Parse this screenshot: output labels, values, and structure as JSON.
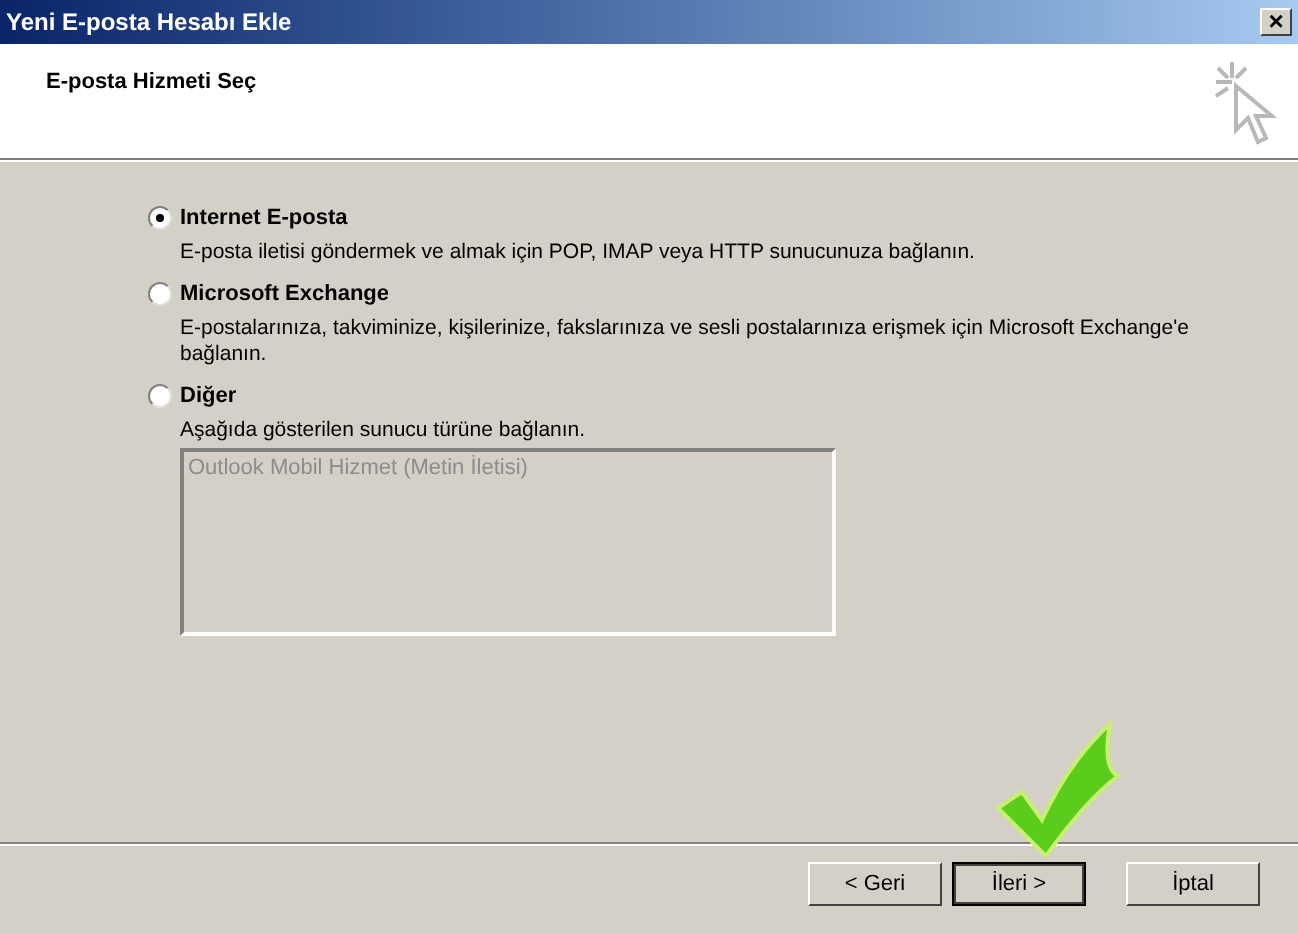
{
  "window": {
    "title": "Yeni E-posta Hesabı Ekle",
    "close": "×"
  },
  "header": {
    "title": "E-posta Hizmeti Seç"
  },
  "options": [
    {
      "label": "Internet E-posta",
      "description": "E-posta iletisi göndermek ve almak için POP, IMAP veya HTTP sunucunuza bağlanın.",
      "selected": true
    },
    {
      "label": "Microsoft Exchange",
      "description": "E-postalarınıza, takviminize, kişilerinize, fakslarınıza ve sesli postalarınıza erişmek için Microsoft Exchange'e bağlanın.",
      "selected": false
    },
    {
      "label": "Diğer",
      "description": "Aşağıda gösterilen sunucu türüne bağlanın.",
      "selected": false,
      "list": {
        "disabled": true,
        "items": [
          "Outlook Mobil Hizmet (Metin İletisi)"
        ]
      }
    }
  ],
  "buttons": [
    {
      "label": "< Geri",
      "default": false
    },
    {
      "label": "İleri >",
      "default": true
    },
    {
      "label": "İptal",
      "default": false
    }
  ]
}
